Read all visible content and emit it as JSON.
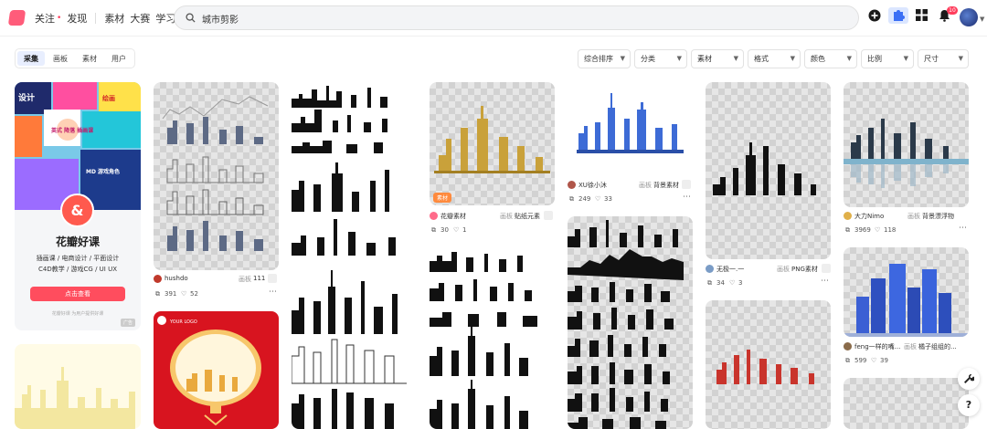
{
  "nav": {
    "follow": "关注",
    "follow_dot": "•",
    "discover": "发现",
    "material": "素材",
    "contest": "大赛",
    "learn": "学习"
  },
  "search": {
    "value": "城市剪影"
  },
  "header": {
    "notification_count": "10"
  },
  "tabs": [
    {
      "label": "采集",
      "active": true
    },
    {
      "label": "画板",
      "active": false
    },
    {
      "label": "素材",
      "active": false
    },
    {
      "label": "用户",
      "active": false
    }
  ],
  "filters": [
    "综合排序",
    "分类",
    "素材",
    "格式",
    "颜色",
    "比例",
    "尺寸"
  ],
  "promo": {
    "title": "花瓣好课",
    "line1": "插画课 / 电商设计 / 平面设计",
    "line2": "C4D教学 / 游戏CG / UI UX",
    "button": "点击查看",
    "note": "花瓣好课 为用户提供好课",
    "ad": "广告",
    "logo_glyph": "&",
    "collage_text": [
      "设计",
      "英式 降落 插画课",
      "MD 游戏角色",
      "绘画"
    ]
  },
  "cards": {
    "c2": {
      "user": "hushdo",
      "board_prefix": "画板",
      "board": "111",
      "saves": "391",
      "likes": "52"
    },
    "c2b": {
      "logo_text": "YOUR LOGO"
    },
    "c4": {
      "tag": "素材",
      "user": "花瓣素材",
      "board_prefix": "画板",
      "board": "贴纸元素",
      "saves": "30",
      "likes": "1"
    },
    "c5": {
      "user": "XU徐小沐",
      "board_prefix": "画板",
      "board": "背景素材",
      "saves": "249",
      "likes": "33"
    },
    "c6": {
      "user": "无极一.一",
      "board_prefix": "画板",
      "board": "PNG素材",
      "saves": "34",
      "likes": "3"
    },
    "c7": {
      "user": "大力Nimo",
      "board_prefix": "画板",
      "board": "背景漂浮物",
      "saves": "3969",
      "likes": "118"
    },
    "c7b": {
      "user": "feng一样的嘴...",
      "board_prefix": "画板",
      "board": "橘子组组的...",
      "saves": "599",
      "likes": "39"
    }
  },
  "icons": {
    "search": "search-icon",
    "add": "plus-circle-icon",
    "plugin": "puzzle-icon",
    "apps": "grid-icon",
    "bell": "bell-icon",
    "tool": "wrench-icon",
    "help": "question-icon",
    "save": "save-icon",
    "like": "heart-icon",
    "more": "more-icon"
  },
  "colors": {
    "accent": "#ff4d5e",
    "tab_active_bg": "#e8eefe",
    "badge": "#ff3d5c"
  },
  "float": {
    "help": "?"
  },
  "more_glyph": "⋯"
}
